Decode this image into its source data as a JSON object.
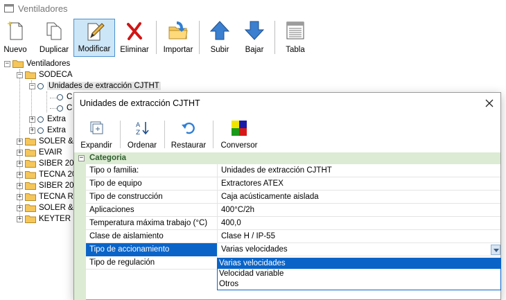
{
  "window": {
    "title": "Ventiladores"
  },
  "toolbar": {
    "buttons": [
      {
        "label": "Nuevo",
        "icon": "new-document-icon"
      },
      {
        "label": "Duplicar",
        "icon": "duplicate-icon"
      },
      {
        "label": "Modificar",
        "icon": "edit-pencil-icon"
      },
      {
        "label": "Eliminar",
        "icon": "delete-x-icon"
      },
      {
        "label": "Importar",
        "icon": "import-folder-icon"
      },
      {
        "label": "Subir",
        "icon": "arrow-up-icon"
      },
      {
        "label": "Bajar",
        "icon": "arrow-down-icon"
      },
      {
        "label": "Tabla",
        "icon": "table-icon"
      }
    ]
  },
  "tree": {
    "root": "Ventiladores",
    "sodeca": "SODECA",
    "cjtht": "Unidades de extracción CJTHT",
    "child1": "C",
    "child2": "C",
    "extra1": "Extra",
    "extra2": "Extra",
    "brands": [
      "SOLER &",
      "EVAIR",
      "SIBER 20",
      "TECNA 20",
      "SIBER 20",
      "TECNA RE",
      "SOLER &",
      "KEYTER"
    ]
  },
  "dialog": {
    "title": "Unidades de extracción CJTHT",
    "toolbar": [
      {
        "label": "Expandir",
        "icon": "expand-icon"
      },
      {
        "label": "Ordenar",
        "icon": "sort-az-icon"
      },
      {
        "label": "Restaurar",
        "icon": "restore-icon"
      },
      {
        "label": "Conversor",
        "icon": "converter-colors-icon"
      }
    ],
    "category": "Categoria",
    "properties": [
      {
        "name": "Tipo o familia:",
        "value": "Unidades de extracción CJTHT"
      },
      {
        "name": "Tipo de equipo",
        "value": "Extractores ATEX"
      },
      {
        "name": "Tipo de construcción",
        "value": "Caja acústicamente aislada"
      },
      {
        "name": "Aplicaciones",
        "value": "400°C/2h"
      },
      {
        "name": "Temperatura máxima trabajo (°C)",
        "value": "400,0"
      },
      {
        "name": "Clase de aislamiento",
        "value": "Clase H / IP-55"
      },
      {
        "name": "Tipo de accionamiento",
        "value": "Varias velocidades"
      },
      {
        "name": "Tipo de regulación",
        "value": ""
      }
    ],
    "dropdown_options": [
      "Varias velocidades",
      "Velocidad variable",
      "Otros"
    ]
  },
  "colors": {
    "selection": "#0a64c8",
    "category_bg": "#dcebd3",
    "active_tool": "#cde6f7"
  }
}
